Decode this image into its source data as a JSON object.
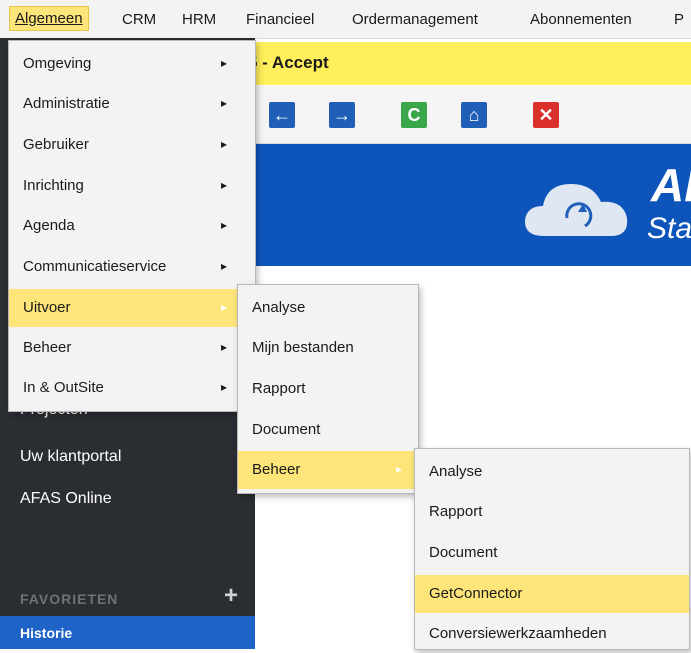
{
  "menubar": {
    "items": [
      "Algemeen",
      "CRM",
      "HRM",
      "Financieel",
      "Ordermanagement",
      "Abonnementen",
      "P"
    ]
  },
  "titlebar": {
    "text": "5 - Accept"
  },
  "toolbar": {
    "buttons": [
      {
        "icon": "arrow-left-icon",
        "glyph": "←",
        "color": "#1f5fb7"
      },
      {
        "icon": "arrow-right-icon",
        "glyph": "→",
        "color": "#1f5fb7"
      },
      {
        "icon": "refresh-icon",
        "glyph": "C",
        "color": "#3aa64a"
      },
      {
        "icon": "home-icon",
        "glyph": "⌂",
        "color": "#1f5fb7"
      },
      {
        "icon": "close-icon",
        "glyph": "✕",
        "color": "#d9302c"
      }
    ]
  },
  "banner": {
    "logo": "Al",
    "subtitle": "Sta",
    "color": "#0e55bb"
  },
  "sidebar": {
    "items": [
      "Projecten",
      "Uw klantportal",
      "AFAS Online"
    ],
    "favorites_label": "FAVORIETEN",
    "plus": "+",
    "history_label": "Historie"
  },
  "menu1": {
    "items": [
      {
        "label": "Omgeving",
        "arrow": "▸"
      },
      {
        "label": "Administratie",
        "arrow": "▸"
      },
      {
        "label": "Gebruiker",
        "arrow": "▸"
      },
      {
        "label": "Inrichting",
        "arrow": "▸"
      },
      {
        "label": "Agenda",
        "arrow": "▸"
      },
      {
        "label": "Communicatieservice",
        "arrow": "▸"
      },
      {
        "label": "Uitvoer",
        "arrow": "▸"
      },
      {
        "label": "Beheer",
        "arrow": "▸"
      },
      {
        "label": "In & OutSite",
        "arrow": "▸"
      }
    ]
  },
  "menu2": {
    "items": [
      {
        "label": "Analyse"
      },
      {
        "label": "Mijn bestanden"
      },
      {
        "label": "Rapport"
      },
      {
        "label": "Document"
      },
      {
        "label": "Beheer",
        "arrow": "▸"
      }
    ]
  },
  "menu3": {
    "items": [
      {
        "label": "Analyse"
      },
      {
        "label": "Rapport"
      },
      {
        "label": "Document"
      },
      {
        "label": "GetConnector"
      },
      {
        "label": "Conversiewerkzaamheden"
      }
    ]
  },
  "colors": {
    "highlight": "#fde57a",
    "title_yellow": "#ffef5c",
    "sidebar": "#2a2e33"
  }
}
